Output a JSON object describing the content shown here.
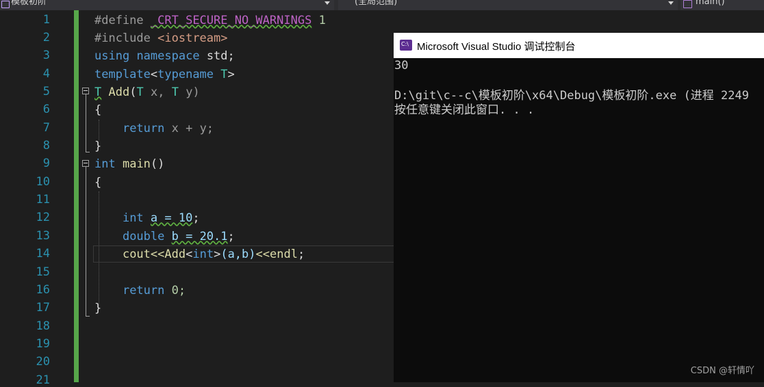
{
  "navbar": {
    "project": "模板初阶",
    "scope": "(全局范围)",
    "member": "main()"
  },
  "line_numbers": [
    "1",
    "2",
    "3",
    "4",
    "5",
    "6",
    "7",
    "8",
    "9",
    "10",
    "11",
    "12",
    "13",
    "14",
    "15",
    "16",
    "17",
    "18",
    "19",
    "20",
    "21"
  ],
  "code": {
    "l1_define": "#define",
    "l1_macro": "_CRT_SECURE_NO_WARNINGS",
    "l1_value": "1",
    "l2_include": "#include",
    "l2_header": "<iostream>",
    "l3_using": "using",
    "l3_namespace": "namespace",
    "l3_std": "std;",
    "l4_template": "template",
    "l4_open": "<",
    "l4_typename": "typename",
    "l4_T": "T",
    "l4_close": ">",
    "l5_ret": "T",
    "l5_name": "Add",
    "l5_params_open": "(",
    "l5_T1": "T",
    "l5_x": "x,",
    "l5_T2": "T",
    "l5_y": "y)",
    "l6": "{",
    "l7_return": "return",
    "l7_expr": "x + y;",
    "l8": "}",
    "l9_int": "int",
    "l9_main": "main",
    "l9_parens": "()",
    "l10": "{",
    "l12_int": "int",
    "l12_decl": "a = 10",
    "l12_semi": ";",
    "l13_double": "double",
    "l13_decl": "b = 20.1",
    "l13_semi": ";",
    "l14_cout": "cout",
    "l14_op1": "<<",
    "l14_add": "Add",
    "l14_lt": "<",
    "l14_int": "int",
    "l14_gt": ">",
    "l14_args": "(a,b)",
    "l14_op2": "<<",
    "l14_endl": "endl",
    "l14_semi": ";",
    "l16_return": "return",
    "l16_zero": "0;",
    "l17": "}"
  },
  "console": {
    "title": "Microsoft Visual Studio 调试控制台",
    "output_value": "30",
    "exit_line": "D:\\git\\c--c\\模板初阶\\x64\\Debug\\模板初阶.exe (进程 2249",
    "press_key": "按任意键关闭此窗口. . ."
  },
  "watermark": "CSDN @轩情吖",
  "colors": {
    "keyword": "#569cd6",
    "type": "#4ec9b0",
    "function": "#dcdcaa",
    "number": "#b5cea8",
    "line_number": "#2b91af",
    "change_bar": "#57a64a",
    "console_bg": "#0c0c0c"
  }
}
